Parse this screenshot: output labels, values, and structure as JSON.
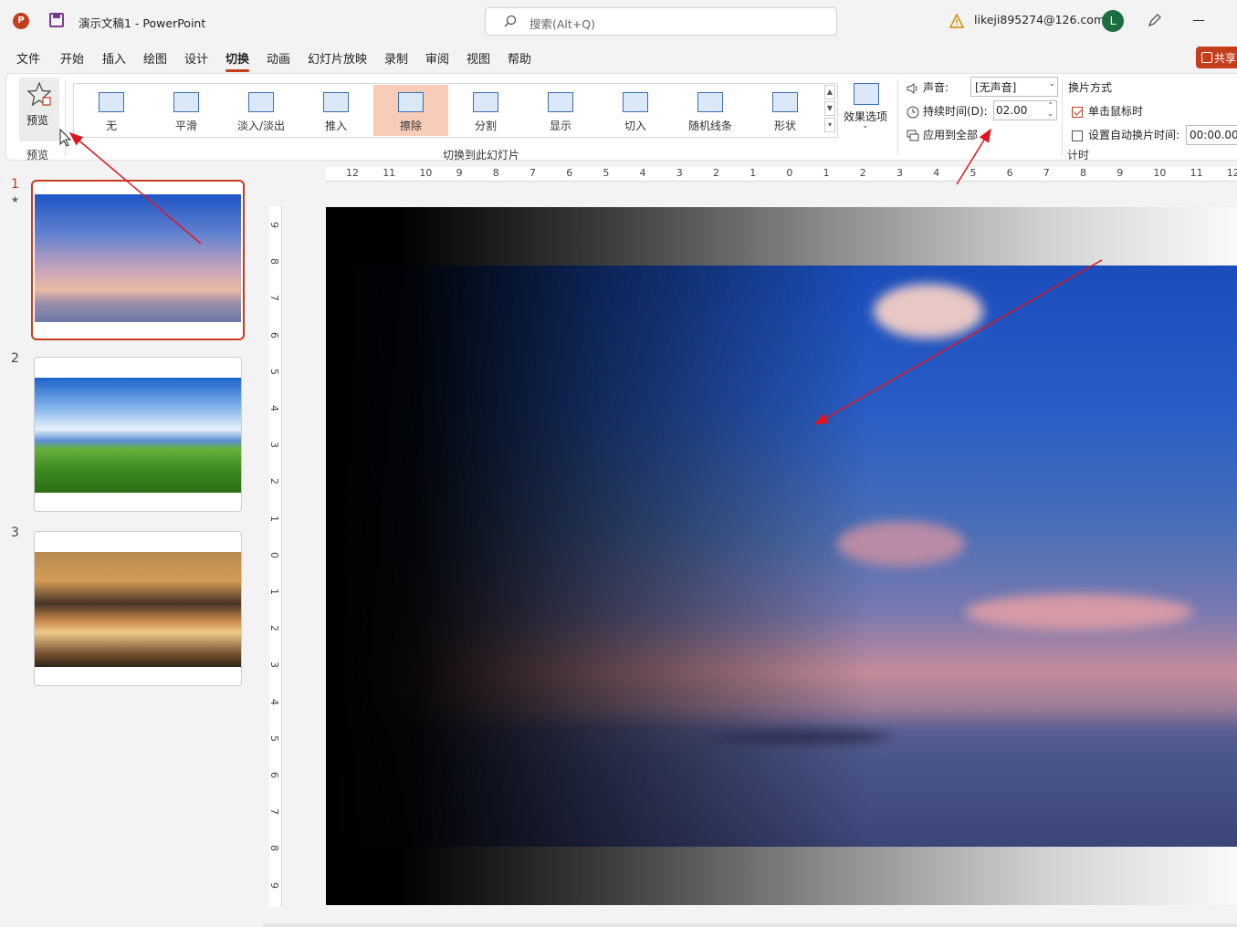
{
  "titlebar": {
    "doc_title": "演示文稿1  -  PowerPoint",
    "search_placeholder": "搜索(Alt+Q)",
    "account": "likeji895274@126.com",
    "avatar_initial": "L",
    "app_icon_letter": "P"
  },
  "menu": {
    "tabs": [
      "文件",
      "开始",
      "插入",
      "绘图",
      "设计",
      "切换",
      "动画",
      "幻灯片放映",
      "录制",
      "审阅",
      "视图",
      "帮助"
    ],
    "active_tab": "切换",
    "share_label": "共享"
  },
  "ribbon": {
    "preview_label": "预览",
    "preview_group_label": "预览",
    "transitions": [
      "无",
      "平滑",
      "淡入/淡出",
      "推入",
      "擦除",
      "分割",
      "显示",
      "切入",
      "随机线条",
      "形状"
    ],
    "selected_transition": "擦除",
    "transition_group_label": "切换到此幻灯片",
    "effect_options_label": "效果选项",
    "sound_label": "声音:",
    "sound_value": "[无声音]",
    "duration_label": "持续时间(D):",
    "duration_value": "02.00",
    "apply_all_label": "应用到全部",
    "timing_group_label": "计时",
    "advance_label": "换片方式",
    "on_click_label": "单击鼠标时",
    "on_click_checked": true,
    "auto_after_label": "设置自动换片时间:",
    "auto_after_checked": false,
    "auto_after_value": "00:00.00"
  },
  "slides": [
    {
      "number": "1",
      "star": "★"
    },
    {
      "number": "2"
    },
    {
      "number": "3"
    }
  ],
  "rulers": {
    "horizontal": [
      "12",
      "11",
      "10",
      "9",
      "8",
      "7",
      "6",
      "5",
      "4",
      "3",
      "2",
      "1",
      "0",
      "1",
      "2",
      "3",
      "4",
      "5",
      "6",
      "7",
      "8",
      "9",
      "10",
      "11",
      "12"
    ],
    "vertical": [
      "9",
      "8",
      "7",
      "6",
      "5",
      "4",
      "3",
      "2",
      "1",
      "0",
      "1",
      "2",
      "3",
      "4",
      "5",
      "6",
      "7",
      "8",
      "9"
    ]
  },
  "colors": {
    "accent": "#c43e1c",
    "annotation_arrow": "#e0141e"
  }
}
